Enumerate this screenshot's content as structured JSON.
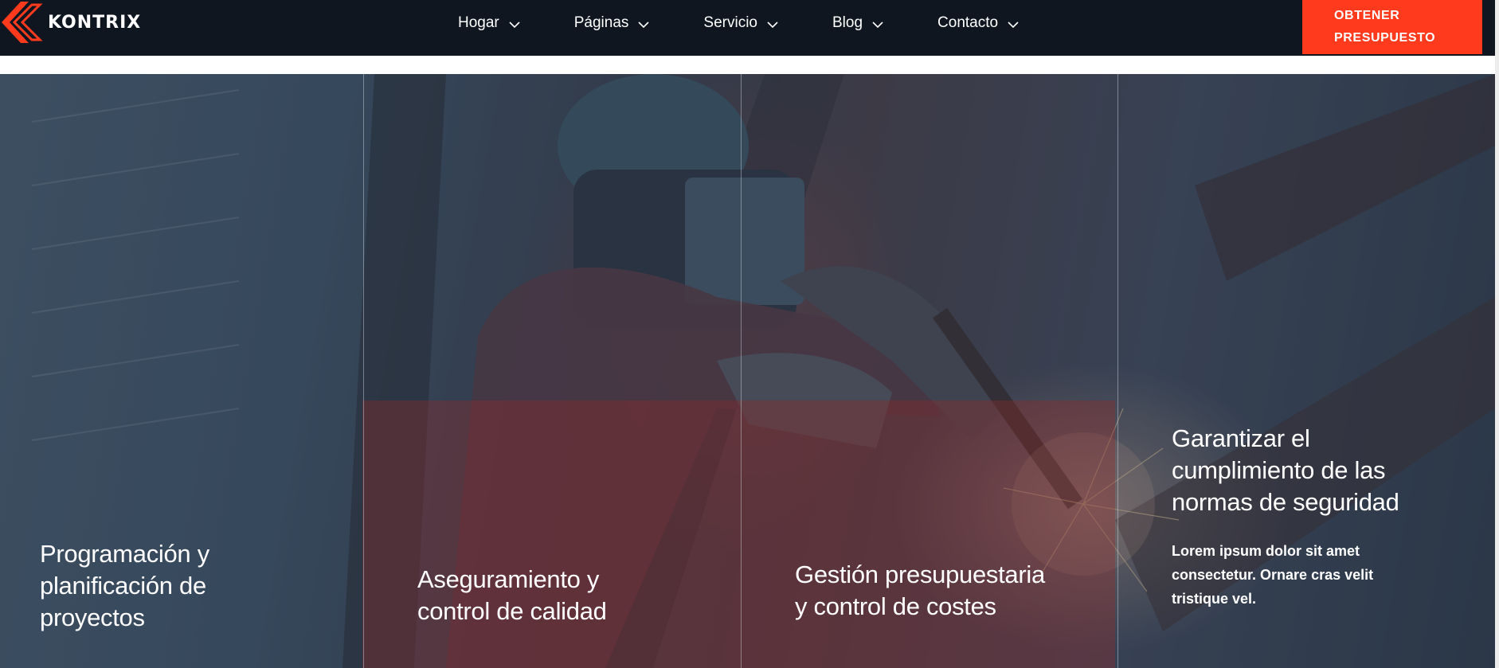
{
  "brand": {
    "name": "KONTRIX",
    "accent": "#ff3a1d",
    "header_bg": "#0f1620"
  },
  "nav": {
    "items": [
      {
        "label": "Hogar",
        "icon": "chevron-down-icon"
      },
      {
        "label": "Páginas",
        "icon": "chevron-down-icon"
      },
      {
        "label": "Servicio",
        "icon": "chevron-down-icon"
      },
      {
        "label": "Blog",
        "icon": "chevron-down-icon"
      },
      {
        "label": "Contacto",
        "icon": "chevron-down-icon"
      }
    ]
  },
  "cta": {
    "line1": "OBTENER",
    "line2": "PRESUPUESTO"
  },
  "features": [
    {
      "title_l1": "Programación y",
      "title_l2": "planificación de",
      "title_l3": "proyectos"
    },
    {
      "title_l1": "Aseguramiento y",
      "title_l2": "control de calidad"
    },
    {
      "title_l1": "Gestión presupuestaria",
      "title_l2": "y control de costes"
    },
    {
      "title_l1": "Garantizar el",
      "title_l2": "cumplimiento de las",
      "title_l3": "normas de seguridad",
      "text_l1": "Lorem ipsum dolor sit amet",
      "text_l2": "consectetur. Ornare cras velit",
      "text_l3": "tristique vel."
    }
  ]
}
